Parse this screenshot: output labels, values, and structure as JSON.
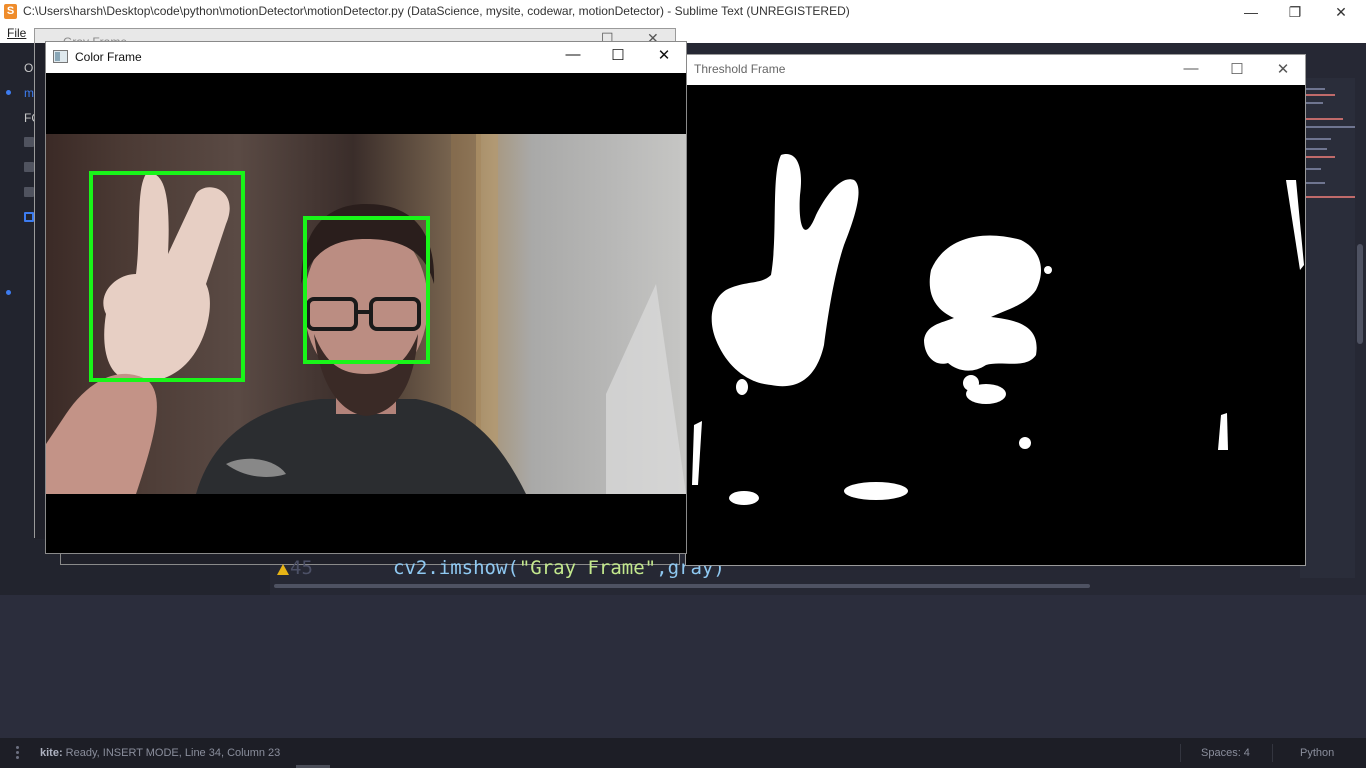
{
  "sublime": {
    "title": "C:\\Users\\harsh\\Desktop\\code\\python\\motionDetector\\motionDetector.py (DataScience, mysite, codewar, motionDetector) - Sublime Text (UNREGISTERED)",
    "menu_file": "File",
    "sidebar": {
      "open_label": "O",
      "file_label": "m",
      "folders_label": "FC"
    },
    "editor": {
      "line_number": "45",
      "code_prefix": "cv2.imshow(",
      "code_string": "\"Gray Frame\"",
      "code_suffix": ",gray)"
    },
    "status": {
      "kite_label": "kite:",
      "left_text": " Ready, INSERT MODE, Line 34, Column 23",
      "spaces": "Spaces: 4",
      "syntax": "Python"
    }
  },
  "windows": {
    "gray": {
      "title": "Gray Frame"
    },
    "threshold": {
      "title": "Threshold Frame"
    },
    "color": {
      "title": "Color Frame"
    }
  },
  "controls": {
    "minimize": "—",
    "maximize": "☐",
    "restore": "❐",
    "close": "✕"
  },
  "colors": {
    "detection_box": "#19f519",
    "accent_blue": "#3d7cf0",
    "warning": "#e7b416"
  },
  "icons": [
    "sublime-logo-icon",
    "warning-icon",
    "window-icon",
    "minimize-icon",
    "maximize-icon",
    "close-icon",
    "restore-icon"
  ]
}
